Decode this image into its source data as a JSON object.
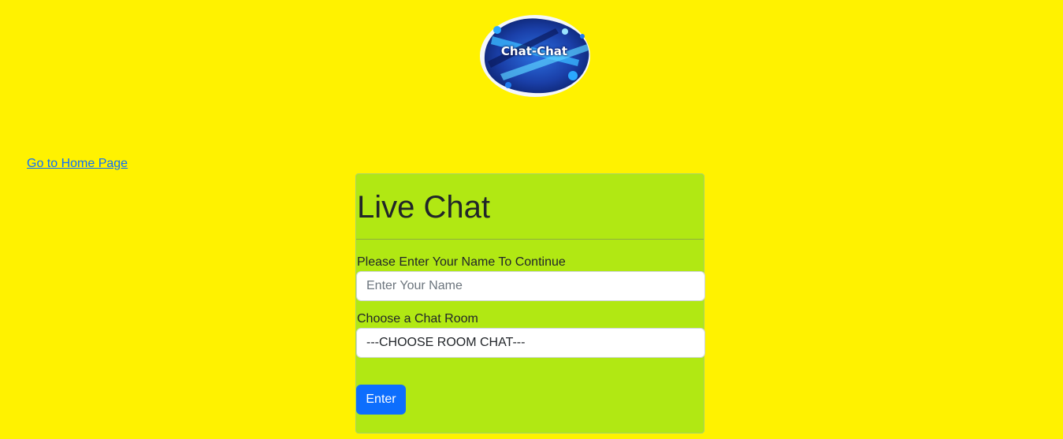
{
  "logo": {
    "text": "Chat-Chat",
    "icon": "chat-chat-logo"
  },
  "nav": {
    "home_link": "Go to Home Page"
  },
  "card": {
    "title": "Live Chat",
    "name_label": "Please Enter Your Name To Continue",
    "name_placeholder": "Enter Your Name",
    "name_value": "",
    "room_label": "Choose a Chat Room",
    "room_selected": "---CHOOSE ROOM CHAT---",
    "submit_label": "Enter"
  },
  "colors": {
    "page_background": "#fff200",
    "card_background": "#b1e813",
    "button_primary": "#0d6efd",
    "link": "#0d6efd"
  }
}
